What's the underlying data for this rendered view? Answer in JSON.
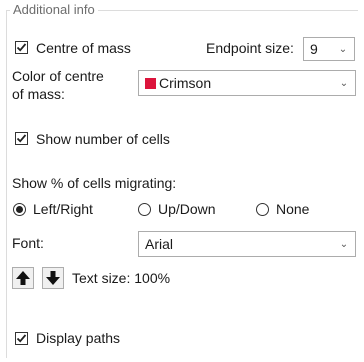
{
  "group": {
    "title": "Additional info"
  },
  "centre_of_mass": {
    "label": "Centre of mass",
    "checked": true
  },
  "endpoint_size": {
    "label": "Endpoint size:",
    "value": "9"
  },
  "color_of_centre_of_mass": {
    "label_line1": "Color of centre",
    "label_line2": "of mass:",
    "value": "Crimson",
    "swatch_color": "#DC143C"
  },
  "show_number_of_cells": {
    "label": "Show number of cells",
    "checked": true
  },
  "show_percent": {
    "label": "Show % of cells migrating:",
    "options": [
      "Left/Right",
      "Up/Down",
      "None"
    ],
    "selected": "Left/Right"
  },
  "font": {
    "label": "Font:",
    "value": "Arial"
  },
  "text_size": {
    "label": "Text size: 100%"
  },
  "display_paths": {
    "label": "Display paths",
    "checked": true
  },
  "icons": {
    "up": "arrow-up-icon",
    "down": "arrow-down-icon",
    "dropdown": "chevron-down-icon",
    "check": "check-icon"
  }
}
